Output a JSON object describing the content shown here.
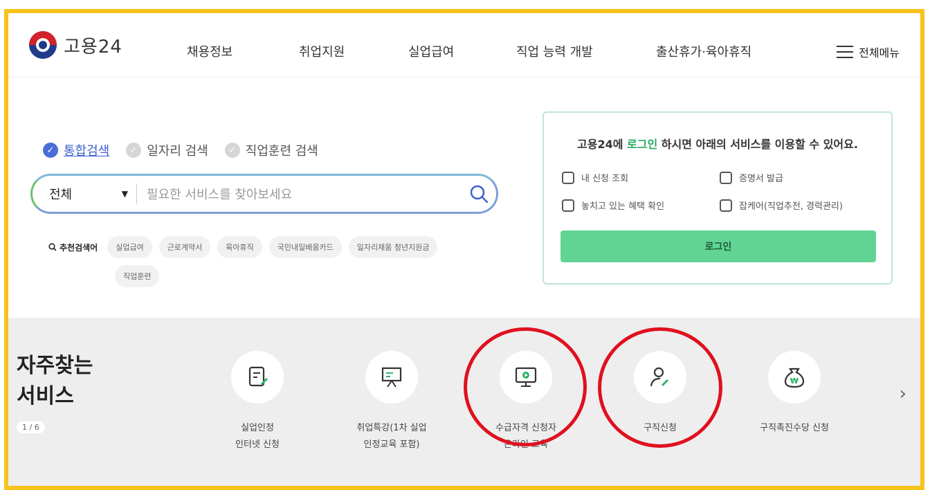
{
  "brand": {
    "name": "고용24"
  },
  "nav": [
    "채용정보",
    "취업지원",
    "실업급여",
    "직업 능력 개발",
    "출산휴가·육아휴직"
  ],
  "menu_all": "전체메뉴",
  "search": {
    "tabs": [
      {
        "label": "통합검색",
        "active": true
      },
      {
        "label": "일자리 검색",
        "active": false
      },
      {
        "label": "직업훈련 검색",
        "active": false
      }
    ],
    "category": "전체",
    "placeholder": "필요한 서비스를 찾아보세요"
  },
  "recommended": {
    "title": "추천검색어",
    "chips": [
      "실업급여",
      "근로계약서",
      "육아휴직",
      "국민내일배움카드",
      "일자리채움 청년지원금",
      "직업훈련"
    ]
  },
  "login_panel": {
    "pre": "고용24에 ",
    "link": "로그인",
    "post": " 하시면 아래의 서비스를 이용할 수 있어요.",
    "services": [
      "내 신청 조회",
      "증명서 발급",
      "놓치고 있는 혜택 확인",
      "잡케어(직업추천, 경력관리)"
    ],
    "button": "로그인"
  },
  "frequent": {
    "heading_line1": "자주찾는",
    "heading_line2": "서비스",
    "page": "1 / 6",
    "items": [
      {
        "line1": "실업인정",
        "line2": "인터넷 신청",
        "icon": "document-pen-icon",
        "circled": false
      },
      {
        "line1": "취업특강(1차 실업",
        "line2": "인정교육 포함)",
        "icon": "presentation-board-icon",
        "circled": false
      },
      {
        "line1": "수급자격 신청자",
        "line2": "온라인 교육",
        "icon": "monitor-play-icon",
        "circled": true
      },
      {
        "line1": "구직신청",
        "line2": "",
        "icon": "person-pen-icon",
        "circled": true
      },
      {
        "line1": "구직촉진수당 신청",
        "line2": "",
        "icon": "money-bag-icon",
        "circled": false
      }
    ]
  },
  "colors": {
    "frame": "#f6c21c",
    "accent_green": "#61d494",
    "active_blue": "#4b6fd6",
    "annotation_red": "#e0101f"
  }
}
